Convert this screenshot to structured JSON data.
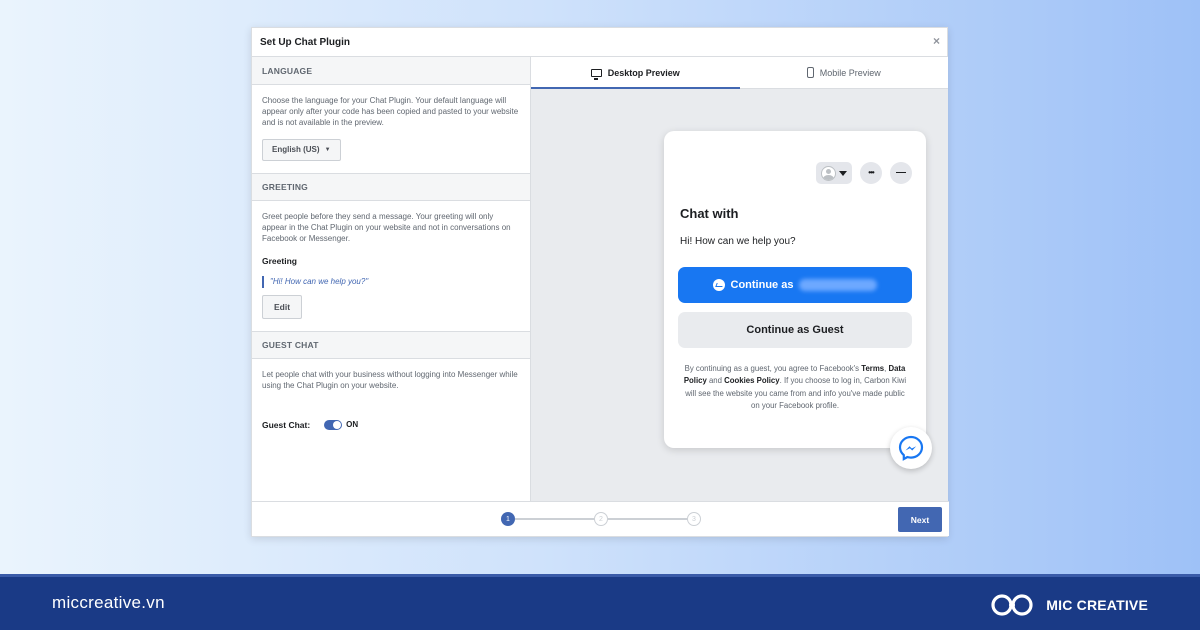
{
  "dialog": {
    "title": "Set Up Chat Plugin",
    "close_glyph": "×"
  },
  "language": {
    "heading": "LANGUAGE",
    "description": "Choose the language for your Chat Plugin. Your default language will appear only after your code has been copied and pasted to your website and is not available in the preview.",
    "selected": "English (US)"
  },
  "greeting": {
    "heading": "GREETING",
    "description": "Greet people before they send a message. Your greeting will only appear in the Chat Plugin on your website and not in conversations on Facebook or Messenger.",
    "label": "Greeting",
    "text": "\"Hi! How can we help you?\"",
    "edit_label": "Edit"
  },
  "guest_chat": {
    "heading": "GUEST CHAT",
    "description": "Let people chat with your business without logging into Messenger while using the Chat Plugin on your website.",
    "label": "Guest Chat:",
    "state": "ON"
  },
  "preview": {
    "tabs": [
      {
        "label": "Desktop Preview",
        "active": true
      },
      {
        "label": "Mobile Preview",
        "active": false
      }
    ],
    "card": {
      "title": "Chat with",
      "greeting": "Hi! How can we help you?",
      "continue_as": "Continue as",
      "continue_guest": "Continue as Guest",
      "menu_glyph": "•••",
      "minimize_glyph": "—",
      "legal": {
        "p1": "By continuing as a guest, you agree to Facebook's",
        "terms": "Terms",
        "comma": ",",
        "data_policy": "Data Policy",
        "and": "and",
        "cookies": "Cookies Policy",
        "p2": ". If you choose to log in, Carbon Kiwi will see the website you came from and info you've made public on your Facebook profile."
      }
    }
  },
  "footer": {
    "steps": [
      "1",
      "2",
      "3"
    ],
    "current_step": 1,
    "next_label": "Next"
  },
  "brand_bar": {
    "site": "miccreative.vn",
    "brand_name": "MIC CREATIVE"
  },
  "colors": {
    "accent": "#4267b2",
    "messenger_blue": "#1877f2",
    "brand_bar": "#1a3a86"
  }
}
